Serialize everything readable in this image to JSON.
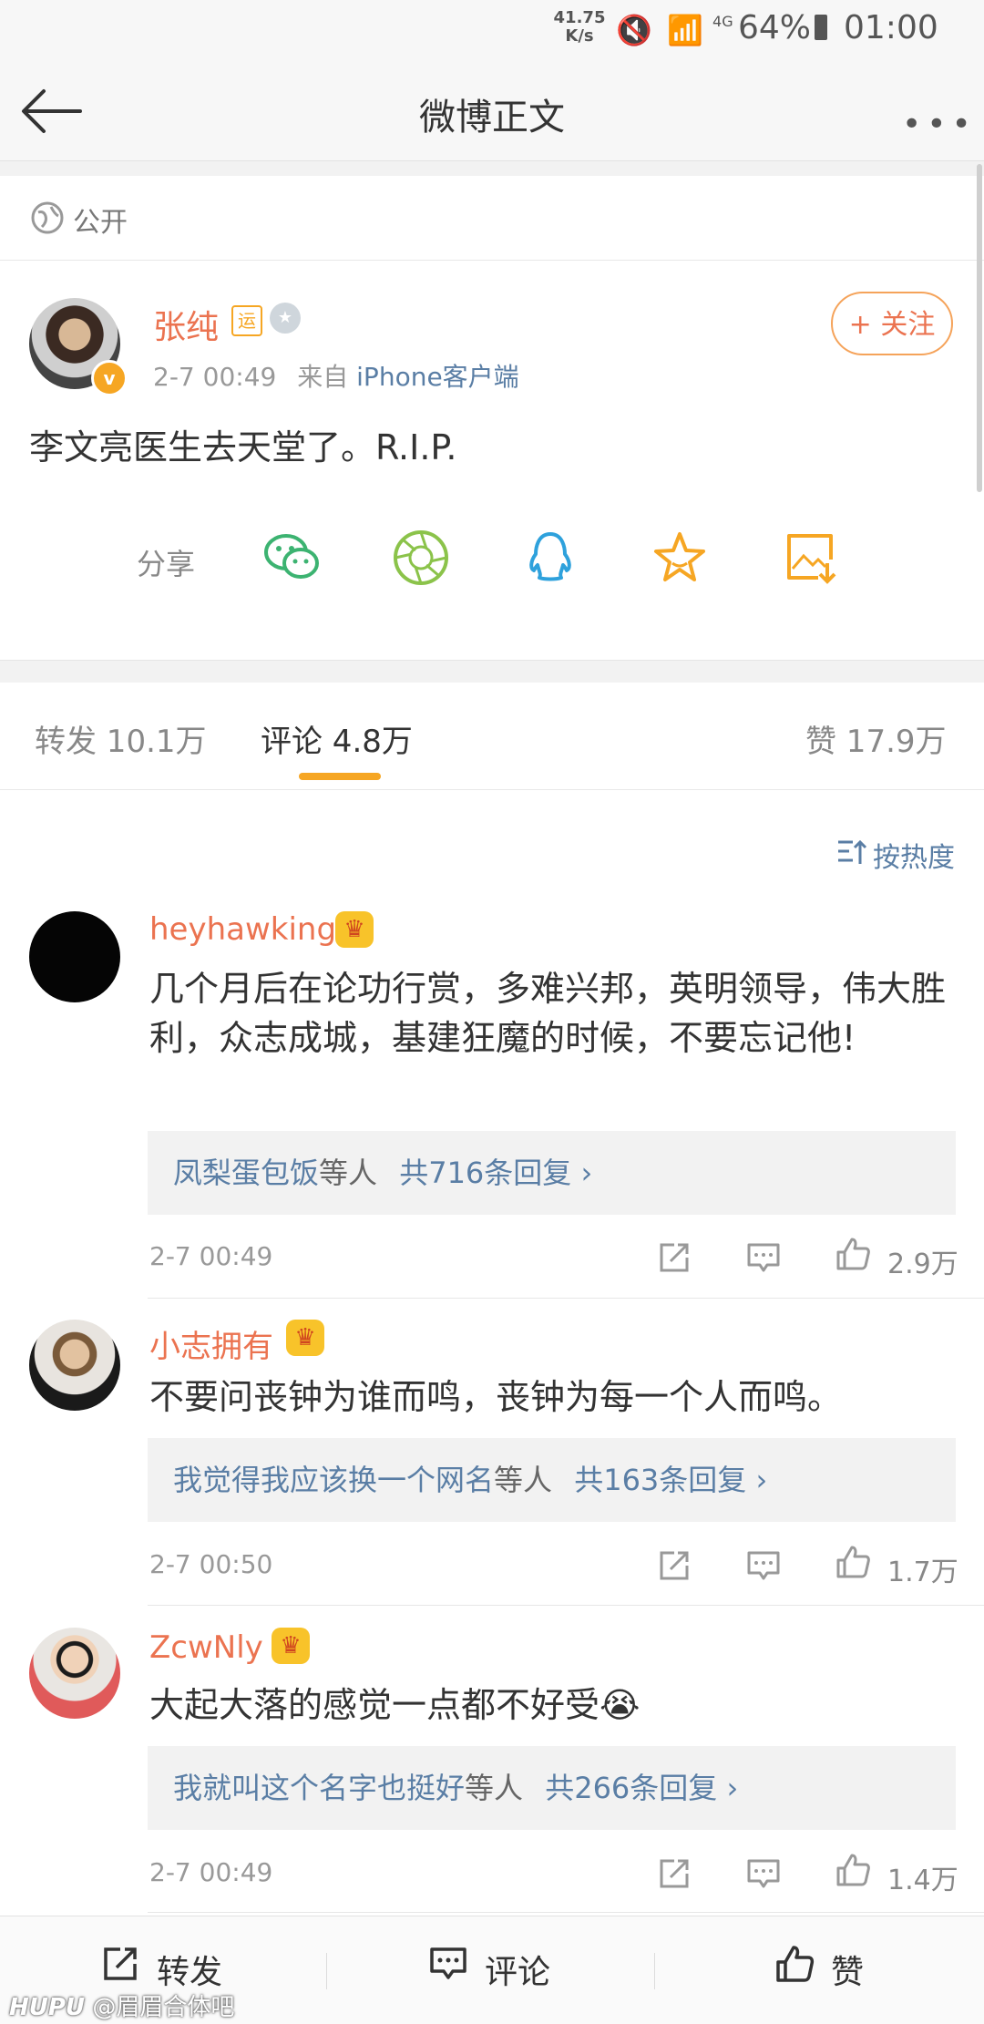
{
  "status_bar": {
    "speed": "41.75\nK/s",
    "speed_top": "41.75",
    "speed_bottom": "K/s",
    "signal": "4G",
    "battery": "64%",
    "time": "01:00"
  },
  "header": {
    "title": "微博正文",
    "more": "•••"
  },
  "post": {
    "visibility": "公开",
    "author": "张纯",
    "badge_yun": "运",
    "time": "2-7 00:49",
    "source_prefix": "来自",
    "source": "iPhone客户端",
    "follow_label": "+ 关注",
    "text": "李文亮医生去天堂了。R.I.P.",
    "share_label": "分享",
    "share_icons": [
      "wechat-icon",
      "moments-icon",
      "qq-icon",
      "favorite-star-icon",
      "save-image-icon"
    ]
  },
  "tabs": {
    "repost": "转发 10.1万",
    "comment": "评论 4.8万",
    "like": "赞 17.9万"
  },
  "sort_label": "按热度",
  "comments": [
    {
      "name": "heyhawking",
      "text": "几个月后在论功行赏，多难兴邦，英明领导，伟大胜利，众志成城，基建狂魔的时候，不要忘记他!",
      "reply_user": "凤梨蛋包饭",
      "reply_mid": "等人",
      "reply_count": "共716条回复 ›",
      "time": "2-7 00:49",
      "likes": "2.9万"
    },
    {
      "name": "小志拥有",
      "text": "不要问丧钟为谁而鸣，丧钟为每一个人而鸣。",
      "reply_user": "我觉得我应该换一个网名",
      "reply_mid": "等人",
      "reply_count": "共163条回复 ›",
      "time": "2-7 00:50",
      "likes": "1.7万"
    },
    {
      "name": "ZcwNly",
      "text": "大起大落的感觉一点都不好受😭",
      "reply_user": "我就叫这个名字也挺好",
      "reply_mid": "等人",
      "reply_count": "共266条回复 ›",
      "time": "2-7 00:49",
      "likes": "1.4万"
    }
  ],
  "bottom_bar": {
    "repost": "转发",
    "comment": "评论",
    "like": "赞"
  },
  "watermark": {
    "brand": "HUPU",
    "text": "@眉眉合体吧"
  },
  "colors": {
    "accent": "#eb7350",
    "link": "#5a7ea5",
    "tab_indicator": "#f6a623"
  }
}
